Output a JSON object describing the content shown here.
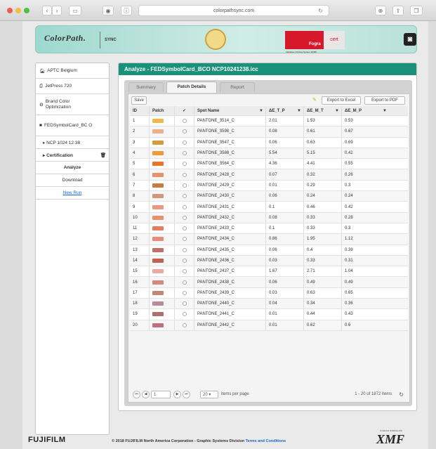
{
  "browser": {
    "url": "colorpathsync.com",
    "reload_icon": "reload-icon",
    "nav_icons": [
      "back-icon",
      "forward-icon",
      "sidebar-icon",
      "shield-icon",
      "info-icon",
      "download-icon",
      "share-icon",
      "tabs-icon"
    ]
  },
  "header": {
    "brand": "ColorPath.",
    "sync": "SYNC",
    "fogra_red": "Fogra",
    "fogra_sub": "Validation Printing System  39386",
    "cert": "cert",
    "settings_icon": "camera-settings-icon"
  },
  "sidebar": {
    "items": [
      {
        "label": "APTC Belgium",
        "icon": "building-icon"
      },
      {
        "label": "JetPress 720",
        "icon": "printer-icon"
      },
      {
        "label": "Brand Color Optimization",
        "icon": "optimize-icon"
      },
      {
        "label": "FEDSymbolCard_BC O",
        "icon": "folder-icon"
      },
      {
        "label": "▸ NCP 1024 12:38"
      },
      {
        "label": "▸ Certification",
        "icon": "trash-icon"
      },
      {
        "label": "Analyze"
      },
      {
        "label": "Download"
      },
      {
        "label": "New Run"
      }
    ]
  },
  "main": {
    "title": "Analyze - FEDSymbolCard_BCO NCP10241238.icc",
    "tabs": [
      "Summary",
      "Patch Details",
      "Report"
    ],
    "active_tab": "Patch Details",
    "save_label": "Save",
    "export_excel": "Export to Excel",
    "export_pdf": "Export to PDF",
    "columns": [
      "ID",
      "Patch",
      "✓",
      "Spot Name",
      "ΔE_T_P",
      "ΔE_M_T",
      "ΔE_M_P"
    ],
    "rows": [
      {
        "id": "1",
        "color": "#f0b84a",
        "name": "PANTONE_3514_C",
        "t_p": "2.01",
        "m_t": "1.53",
        "m_p": "0.53"
      },
      {
        "id": "2",
        "color": "#e6b390",
        "name": "PANTONE_3598_C",
        "t_p": "0.08",
        "m_t": "0.61",
        "m_p": "0.67"
      },
      {
        "id": "3",
        "color": "#d69a3c",
        "name": "PANTONE_3547_C",
        "t_p": "0.06",
        "m_t": "0.63",
        "m_p": "0.69"
      },
      {
        "id": "4",
        "color": "#ed9a3a",
        "name": "PANTONE_3588_C",
        "t_p": "5.54",
        "m_t": "5.15",
        "m_p": "0.42"
      },
      {
        "id": "5",
        "color": "#e8752a",
        "name": "PANTONE_3564_C",
        "t_p": "4.36",
        "m_t": "4.41",
        "m_p": "0.55"
      },
      {
        "id": "6",
        "color": "#e8916a",
        "name": "PANTONE_2428_C",
        "t_p": "0.07",
        "m_t": "0.32",
        "m_p": "0.26"
      },
      {
        "id": "7",
        "color": "#c57a3e",
        "name": "PANTONE_2429_C",
        "t_p": "0.01",
        "m_t": "0.29",
        "m_p": "0.3"
      },
      {
        "id": "8",
        "color": "#d4957a",
        "name": "PANTONE_2430_C",
        "t_p": "0.06",
        "m_t": "0.24",
        "m_p": "0.24"
      },
      {
        "id": "9",
        "color": "#e69a80",
        "name": "PANTONE_2431_C",
        "t_p": "0.1",
        "m_t": "0.46",
        "m_p": "0.42"
      },
      {
        "id": "10",
        "color": "#e89070",
        "name": "PANTONE_2432_C",
        "t_p": "0.08",
        "m_t": "0.33",
        "m_p": "0.28"
      },
      {
        "id": "11",
        "color": "#e67a64",
        "name": "PANTONE_2433_C",
        "t_p": "0.1",
        "m_t": "0.33",
        "m_p": "0.3"
      },
      {
        "id": "12",
        "color": "#e88a7a",
        "name": "PANTONE_2434_C",
        "t_p": "0.86",
        "m_t": "1.95",
        "m_p": "1.12"
      },
      {
        "id": "13",
        "color": "#c46e6a",
        "name": "PANTONE_2435_C",
        "t_p": "0.06",
        "m_t": "0.4",
        "m_p": "0.39"
      },
      {
        "id": "14",
        "color": "#c0604e",
        "name": "PANTONE_2436_C",
        "t_p": "0.03",
        "m_t": "0.33",
        "m_p": "0.31"
      },
      {
        "id": "15",
        "color": "#ecaaa0",
        "name": "PANTONE_2437_C",
        "t_p": "1.67",
        "m_t": "2.71",
        "m_p": "1.04"
      },
      {
        "id": "16",
        "color": "#d08a80",
        "name": "PANTONE_2438_C",
        "t_p": "0.06",
        "m_t": "0.49",
        "m_p": "0.49"
      },
      {
        "id": "17",
        "color": "#c88470",
        "name": "PANTONE_2439_C",
        "t_p": "0.03",
        "m_t": "0.63",
        "m_p": "0.65"
      },
      {
        "id": "18",
        "color": "#b88a98",
        "name": "PANTONE_2440_C",
        "t_p": "0.04",
        "m_t": "0.34",
        "m_p": "0.36"
      },
      {
        "id": "19",
        "color": "#b06c70",
        "name": "PANTONE_2441_C",
        "t_p": "0.01",
        "m_t": "0.44",
        "m_p": "0.43"
      },
      {
        "id": "20",
        "color": "#c0707a",
        "name": "PANTONE_2442_C",
        "t_p": "0.01",
        "m_t": "0.62",
        "m_p": "0.6"
      }
    ],
    "pager": {
      "page": "1",
      "per_page": "20",
      "per_page_label": "items per page",
      "range_text": "1 - 20 of 1872 items"
    }
  },
  "footer": {
    "logo": "FUJIFILM",
    "copyright": "© 2018 FUJIFILM North America Corporation - Graphic Systems Division",
    "terms": "Terms and Conditions",
    "xmf": "XMF",
    "xmf_tag": "FUJIFILM WORKFLOW"
  },
  "colors": {
    "accent": "#19917b",
    "header_bg": "#9ed8cf",
    "link": "#1a66c8",
    "traffic_red": "#ee5d56",
    "traffic_yellow": "#f4be3f",
    "traffic_green": "#4cc144"
  }
}
